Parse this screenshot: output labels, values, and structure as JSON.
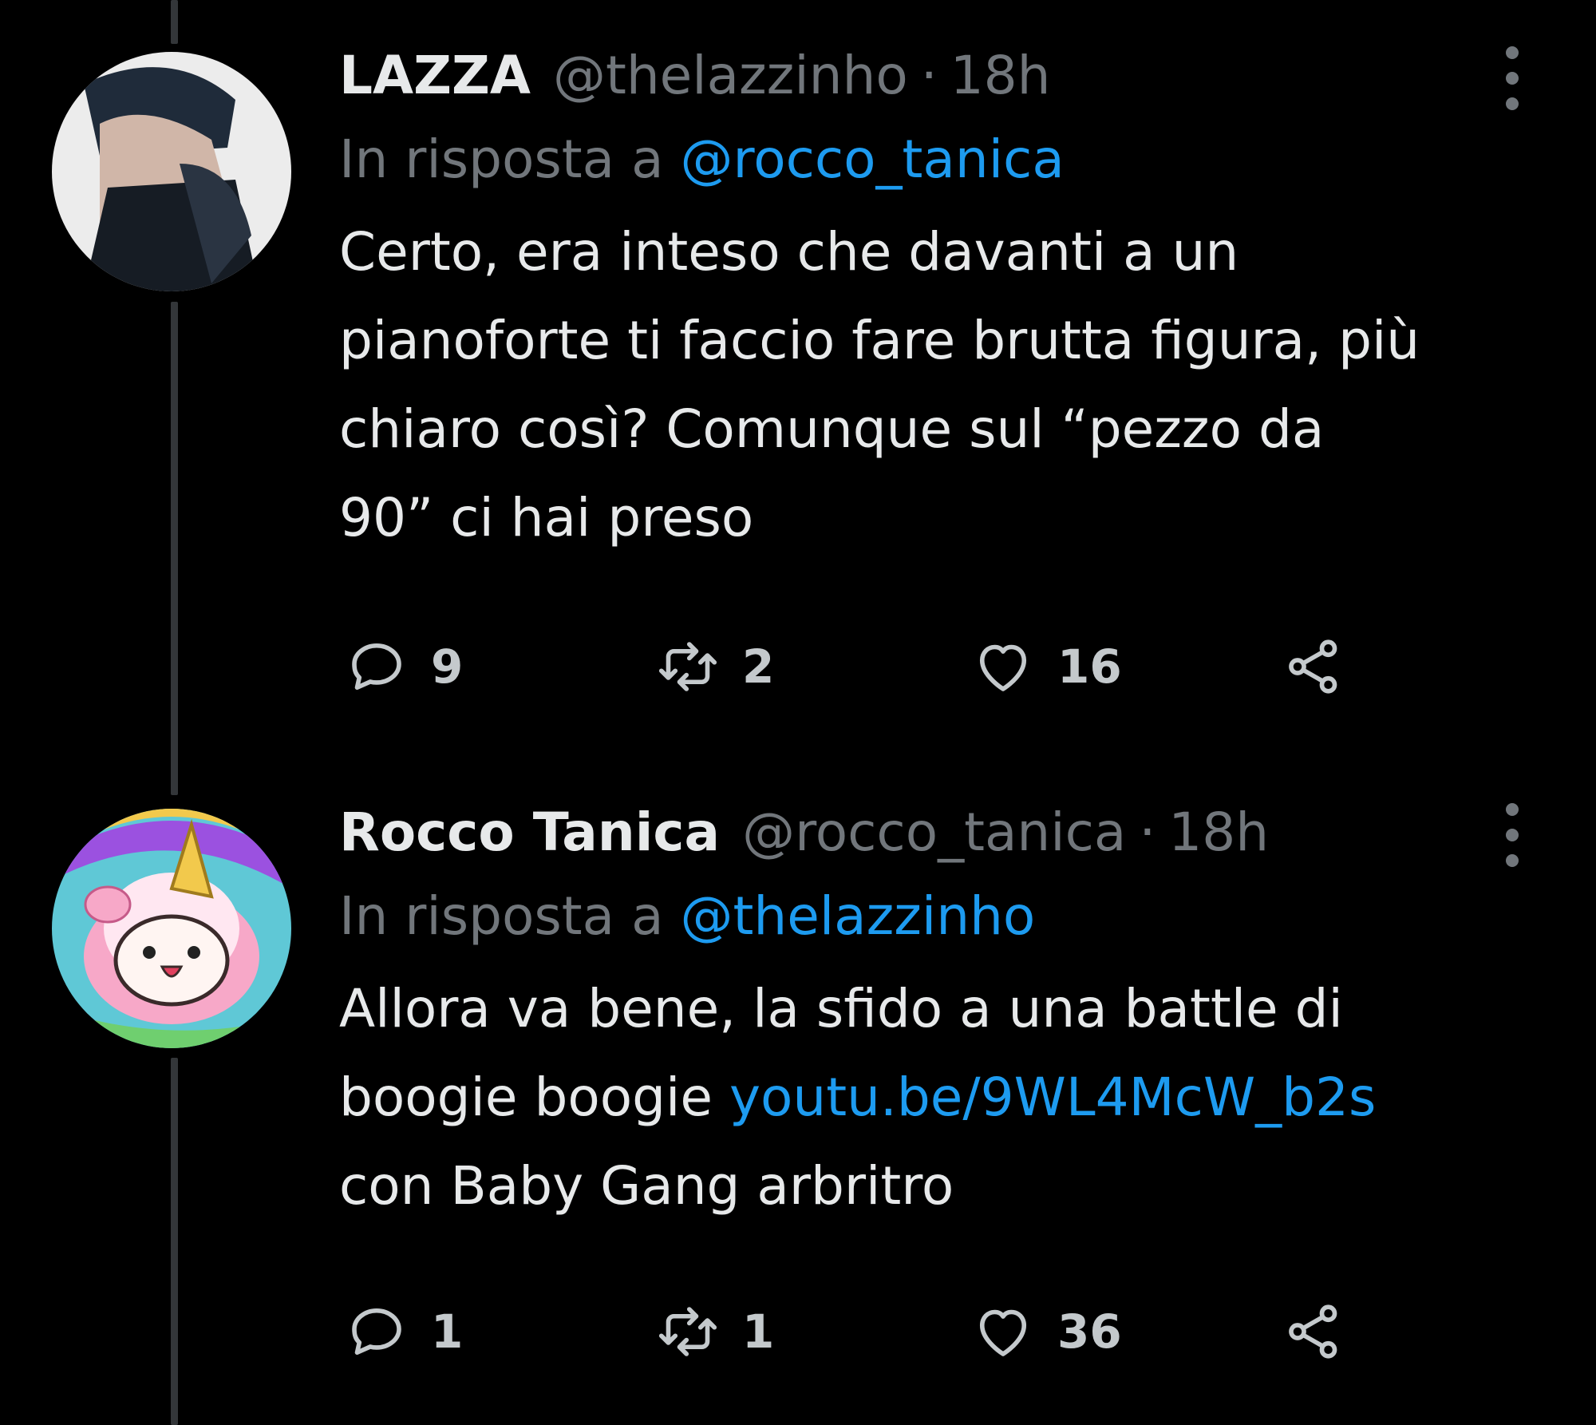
{
  "tweets": [
    {
      "name": "LAZZA",
      "handle": "@thelazzinho",
      "separator": "·",
      "time": "18h",
      "reply_prefix": "In risposta a",
      "reply_to": "@rocco_tanica",
      "text": "Certo, era inteso che davanti a un\npianoforte ti faccio fare brutta figura, più\nchiaro così? Comunque sul “pezzo da\n90” ci hai preso",
      "link": "",
      "text_after_link": "",
      "replies": "9",
      "retweets": "2",
      "likes": "16"
    },
    {
      "name": "Rocco Tanica",
      "handle": "@rocco_tanica",
      "separator": "·",
      "time": "18h",
      "reply_prefix": "In risposta a",
      "reply_to": "@thelazzinho",
      "text": "Allora va bene, la sfido a una battle di\nboogie boogie ",
      "link": "youtu.be/9WL4McW_b2s",
      "text_after_link": "\ncon Baby Gang arbritro",
      "replies": "1",
      "retweets": "1",
      "likes": "36"
    }
  ],
  "icons": {
    "reply": "reply-icon",
    "retweet": "retweet-icon",
    "like": "heart-icon",
    "share": "share-icon",
    "more": "more-icon"
  },
  "colors": {
    "background": "#000000",
    "text": "#e7e9ea",
    "secondary": "#71767b",
    "link": "#1d9bf0",
    "thread_line": "#333639"
  }
}
